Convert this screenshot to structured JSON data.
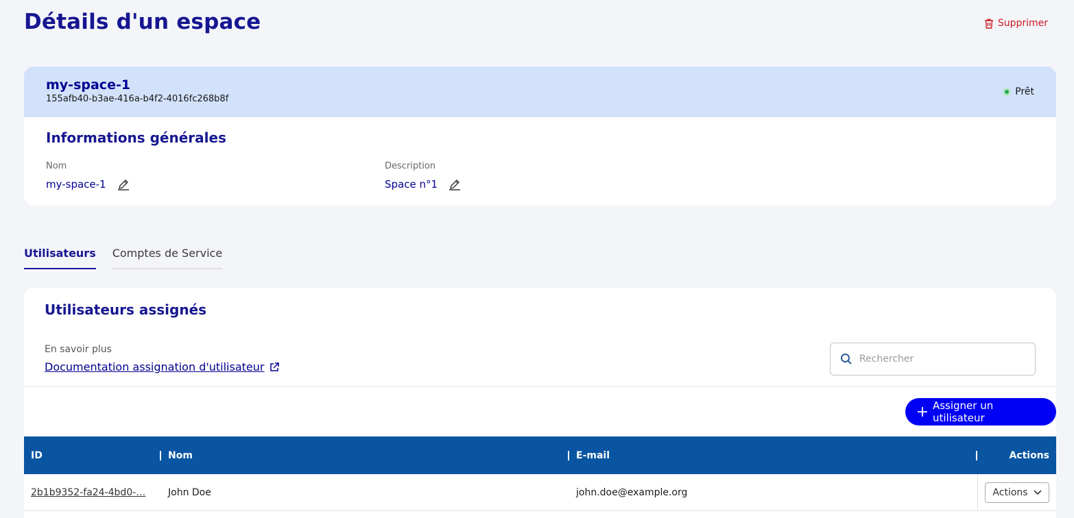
{
  "page": {
    "title": "Détails d'un espace",
    "delete_label": "Supprimer"
  },
  "space": {
    "name": "my-space-1",
    "id": "155afb40-b3ae-416a-b4f2-4016fc268b8f",
    "status": "Prêt"
  },
  "general": {
    "title": "Informations générales",
    "name_label": "Nom",
    "name_value": "my-space-1",
    "desc_label": "Description",
    "desc_value": "Space n°1"
  },
  "tabs": [
    {
      "label": "Utilisateurs",
      "active": true
    },
    {
      "label": "Comptes de Service",
      "active": false
    }
  ],
  "users": {
    "title": "Utilisateurs assignés",
    "learn_more": "En savoir plus",
    "doc_link": "Documentation assignation d'utilisateur",
    "search_placeholder": "Rechercher",
    "assign_label": "Assigner un utilisateur",
    "columns": [
      "ID",
      "Nom",
      "E-mail",
      "Actions"
    ],
    "rows": [
      {
        "id": "2b1b9352-fa24-4bd0-…",
        "name": "John Doe",
        "email": "john.doe@example.org",
        "action": "Actions"
      }
    ]
  },
  "colors": {
    "primary": "#000091",
    "header_bg": "#0955a2",
    "danger": "#c9191e",
    "button": "#0000f5"
  }
}
